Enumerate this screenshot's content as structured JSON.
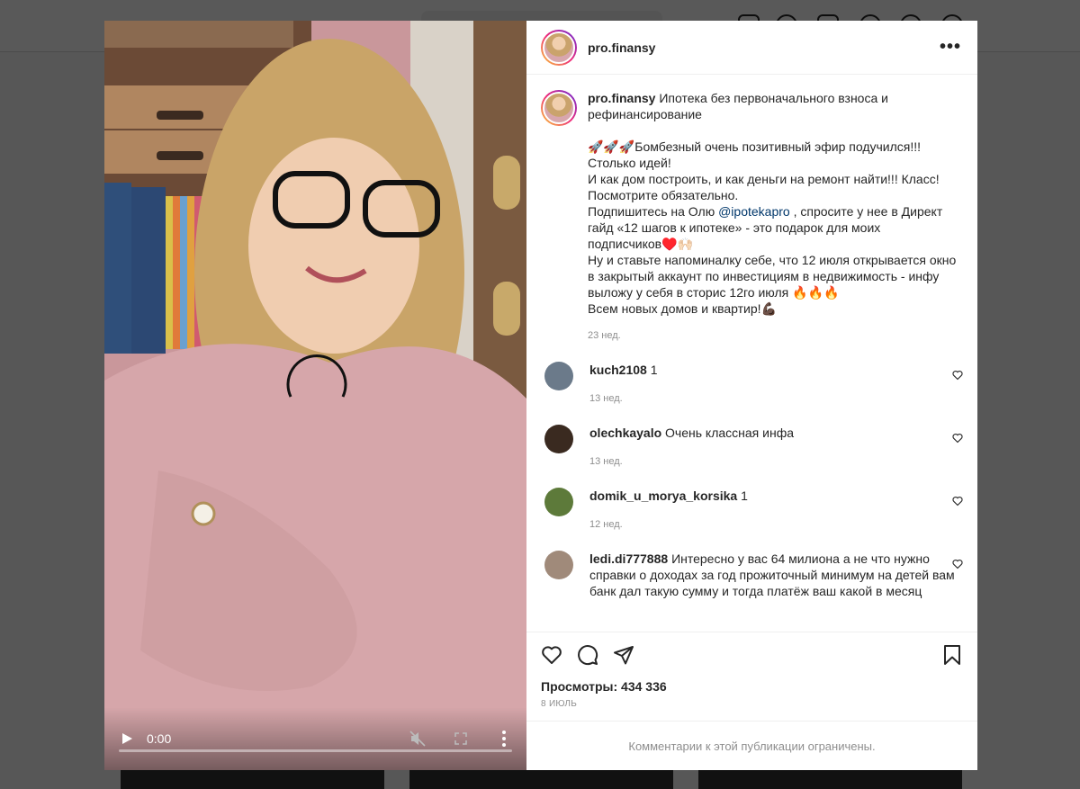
{
  "post": {
    "username": "pro.finansy",
    "caption": {
      "title": "Ипотека без первоначального взноса и рефинансирование",
      "paragraphs": [
        "🚀🚀🚀Бомбезный очень позитивный эфир подучился!!!",
        "Столько идей!",
        "И как дом построить, и как деньги на ремонт найти!!! Класс!",
        "Посмотрите обязательно.",
        "Ну и ставьте напоминалку себе, что 12 июля открывается окно в закрытый аккаунт по инвестициям в недвижимость - инфу выложу у себя в сторис 12го июля 🔥🔥🔥",
        "Всем новых домов и квартир!💪🏿"
      ],
      "subscribe_before": "Подпишитесь на Олю ",
      "mention": "@ipotekapro",
      "subscribe_after": " , спросите у нее в Директ гайд «12 шагов к ипотеке» - это подарок для моих подписчиков♥️🙌🏻",
      "time": "23 нед."
    },
    "comments": [
      {
        "username": "kuch2108",
        "text": "1",
        "time": "13 нед.",
        "avatar_color": "#6b7a8a"
      },
      {
        "username": "olechkayalo",
        "text": "Очень классная инфа",
        "time": "13 нед.",
        "avatar_color": "#3a2a20"
      },
      {
        "username": "domik_u_morya_korsika",
        "text": "1",
        "time": "12 нед.",
        "avatar_color": "#5d7a3a"
      },
      {
        "username": "ledi.di777888",
        "text": "Интересно у вас 64 милиона а не что нужно справки о доходах за год прожиточный минимум на детей вам банк дал такую сумму и тогда платёж ваш какой в месяц",
        "time": "",
        "avatar_color": "#a08a7a"
      }
    ],
    "views_label": "Просмотры: 434 336",
    "date": "8 ИЮЛЬ",
    "comments_restricted": "Комментарии к этой публикации ограничены."
  },
  "video": {
    "current_time": "0:00",
    "progress": 0.0,
    "muted": true
  },
  "icons": {
    "like": "heart-icon",
    "comment": "comment-icon",
    "share": "paper-plane-icon",
    "save": "bookmark-icon",
    "more": "ellipsis-icon",
    "play": "play-icon",
    "mute": "muted-speaker-icon",
    "fullscreen": "fullscreen-icon",
    "video_more": "vertical-ellipsis-icon"
  },
  "colors": {
    "link": "#00376b",
    "muted_text": "#8e8e8e",
    "border": "#efefef"
  }
}
